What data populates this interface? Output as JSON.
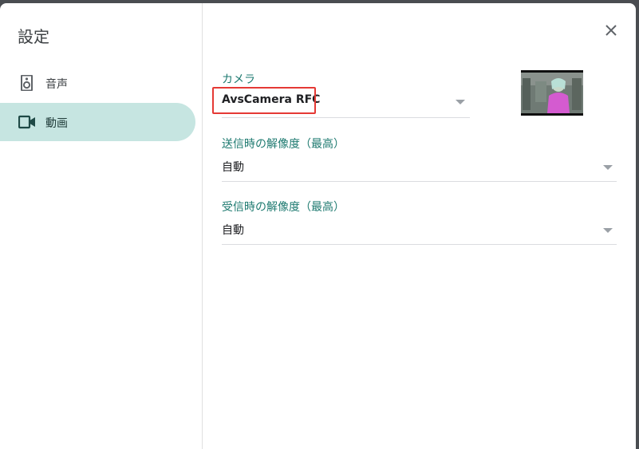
{
  "dialog": {
    "title": "設定",
    "close_icon": "close-icon"
  },
  "sidebar": {
    "items": [
      {
        "label": "音声",
        "icon": "speaker-icon",
        "selected": false
      },
      {
        "label": "動画",
        "icon": "videocam-icon",
        "selected": true
      }
    ]
  },
  "video": {
    "camera": {
      "label": "カメラ",
      "value": "AvsCamera RFC"
    },
    "send_resolution": {
      "label": "送信時の解像度（最高）",
      "value": "自動"
    },
    "receive_resolution": {
      "label": "受信時の解像度（最高）",
      "value": "自動"
    }
  },
  "colors": {
    "accent": "#1e7a70",
    "selected_nav": "#c6e5e1",
    "highlight": "#e53935"
  }
}
